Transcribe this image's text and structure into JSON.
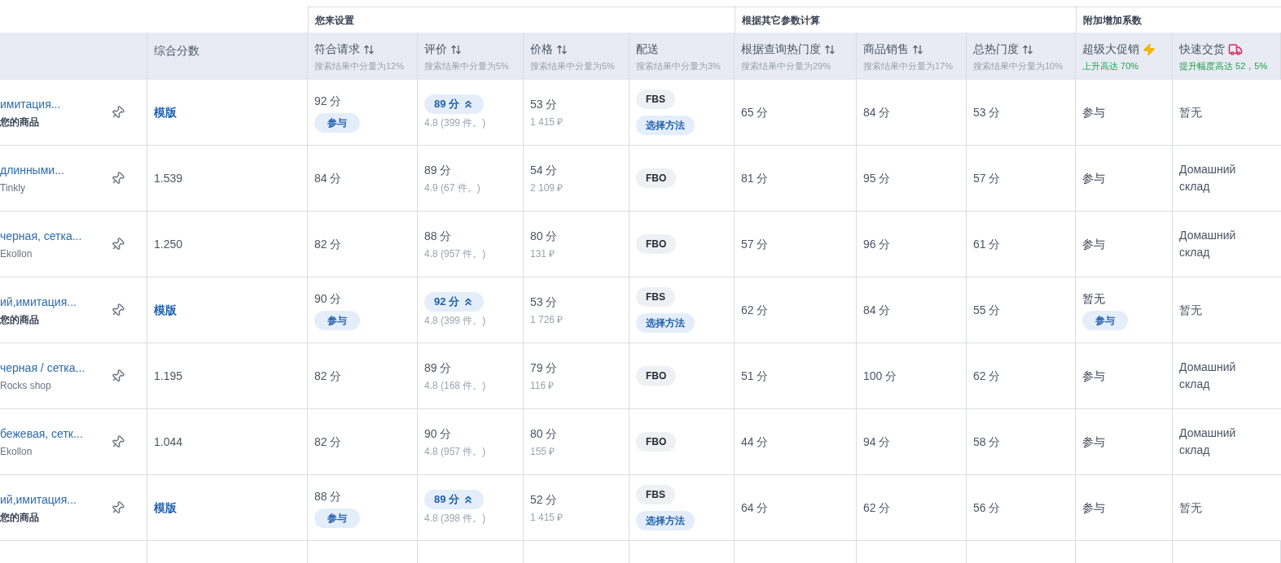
{
  "leading_columns": [
    {
      "label": "综合分数"
    }
  ],
  "column_groups": [
    {
      "label": "您来设置",
      "columns": [
        {
          "label": "符合请求",
          "kind": "sortable",
          "note": "搜索结果中分量为12%",
          "highlight": false
        },
        {
          "label": "评价",
          "kind": "sortable",
          "note": "搜索结果中分量为5%",
          "highlight": false
        },
        {
          "label": "价格",
          "kind": "sortable",
          "note": "搜索结果中分量为5%",
          "highlight": false
        },
        {
          "label": "配送",
          "kind": "plain",
          "note": "搜索结果中分量为3%",
          "highlight": false
        }
      ]
    },
    {
      "label": "根据其它参数计算",
      "columns": [
        {
          "label": "根据查询热门度",
          "kind": "sortable",
          "note": "搜索结果中分量为29%",
          "highlight": false
        },
        {
          "label": "商品销售",
          "kind": "sortable",
          "note": "搜索结果中分量为17%",
          "highlight": false
        },
        {
          "label": "总热门度",
          "kind": "sortable",
          "note": "搜索结果中分量为10%",
          "highlight": false
        }
      ]
    },
    {
      "label": "附加增加系数",
      "columns": [
        {
          "label": "超级大促销",
          "kind": "lightning",
          "note": "上升高达 70%",
          "highlight": true
        },
        {
          "label": "快速交货",
          "kind": "truck",
          "note": "提升幅度高达 52，5%",
          "highlight": true
        }
      ]
    }
  ],
  "rows": [
    {
      "product": {
        "title": "имитация...",
        "seller": "您的商品",
        "own": true
      },
      "overall": {
        "text": "模版",
        "kind": "link"
      },
      "relevance": {
        "score": "92 分",
        "badge": "参与"
      },
      "rating": {
        "score": "89 分",
        "boosted": true,
        "count": "4.8 (399 件。)"
      },
      "price": {
        "score": "53 分",
        "amount": "1 415 ₽"
      },
      "delivery": {
        "tag": "FBS",
        "action": "选择方法"
      },
      "query_popularity": "65 分",
      "sales": "84 分",
      "total_popularity": "53 分",
      "promo": {
        "text": "参与"
      },
      "fast_delivery": "暂无"
    },
    {
      "product": {
        "title": "длинными...",
        "seller": "Tinkly",
        "own": false
      },
      "overall": {
        "text": "1.539",
        "kind": "plain"
      },
      "relevance": {
        "score": "84 分"
      },
      "rating": {
        "score": "89 分",
        "boosted": false,
        "count": "4.9 (67 件。)"
      },
      "price": {
        "score": "54 分",
        "amount": "2 109 ₽"
      },
      "delivery": {
        "tag": "FBO"
      },
      "query_popularity": "81 分",
      "sales": "95 分",
      "total_popularity": "57 分",
      "promo": {
        "text": "参与"
      },
      "fast_delivery": "Домашний склад"
    },
    {
      "product": {
        "title": "черная, сетка...",
        "seller": "Ekollon",
        "own": false
      },
      "overall": {
        "text": "1.250",
        "kind": "plain"
      },
      "relevance": {
        "score": "82 分"
      },
      "rating": {
        "score": "88 分",
        "boosted": false,
        "count": "4.8 (957 件。)"
      },
      "price": {
        "score": "80 分",
        "amount": "131 ₽"
      },
      "delivery": {
        "tag": "FBO"
      },
      "query_popularity": "57 分",
      "sales": "96 分",
      "total_popularity": "61 分",
      "promo": {
        "text": "参与"
      },
      "fast_delivery": "Домашний склад"
    },
    {
      "product": {
        "title": "ий,имитация...",
        "seller": "您的商品",
        "own": true
      },
      "overall": {
        "text": "模版",
        "kind": "link"
      },
      "relevance": {
        "score": "90 分",
        "badge": "参与"
      },
      "rating": {
        "score": "92 分",
        "boosted": true,
        "count": "4.8 (399 件。)"
      },
      "price": {
        "score": "53 分",
        "amount": "1 726 ₽"
      },
      "delivery": {
        "tag": "FBS",
        "action": "选择方法"
      },
      "query_popularity": "62 分",
      "sales": "84 分",
      "total_popularity": "55 分",
      "promo": {
        "text": "暂无",
        "badge": "参与"
      },
      "fast_delivery": "暂无"
    },
    {
      "product": {
        "title": "черная / сетка...",
        "seller": "Rocks shop",
        "own": false
      },
      "overall": {
        "text": "1.195",
        "kind": "plain"
      },
      "relevance": {
        "score": "82 分"
      },
      "rating": {
        "score": "89 分",
        "boosted": false,
        "count": "4.8 (168 件。)"
      },
      "price": {
        "score": "79 分",
        "amount": "116 ₽"
      },
      "delivery": {
        "tag": "FBO"
      },
      "query_popularity": "51 分",
      "sales": "100 分",
      "total_popularity": "62 分",
      "promo": {
        "text": "参与"
      },
      "fast_delivery": "Домашний склад"
    },
    {
      "product": {
        "title": "бежевая, сетк...",
        "seller": "Ekollon",
        "own": false
      },
      "overall": {
        "text": "1.044",
        "kind": "plain"
      },
      "relevance": {
        "score": "82 分"
      },
      "rating": {
        "score": "90 分",
        "boosted": false,
        "count": "4.8 (957 件。)"
      },
      "price": {
        "score": "80 分",
        "amount": "155 ₽"
      },
      "delivery": {
        "tag": "FBO"
      },
      "query_popularity": "44 分",
      "sales": "94 分",
      "total_popularity": "58 分",
      "promo": {
        "text": "参与"
      },
      "fast_delivery": "Домашний склад"
    },
    {
      "product": {
        "title": "ий,имитация...",
        "seller": "您的商品",
        "own": true
      },
      "overall": {
        "text": "模版",
        "kind": "link"
      },
      "relevance": {
        "score": "88 分",
        "badge": "参与"
      },
      "rating": {
        "score": "89 分",
        "boosted": true,
        "count": "4.8 (398 件。)"
      },
      "price": {
        "score": "52 分",
        "amount": "1 415 ₽"
      },
      "delivery": {
        "tag": "FBS",
        "action": "选择方法"
      },
      "query_popularity": "64 分",
      "sales": "62 分",
      "total_popularity": "56 分",
      "promo": {
        "text": "参与"
      },
      "fast_delivery": "暂无"
    }
  ]
}
